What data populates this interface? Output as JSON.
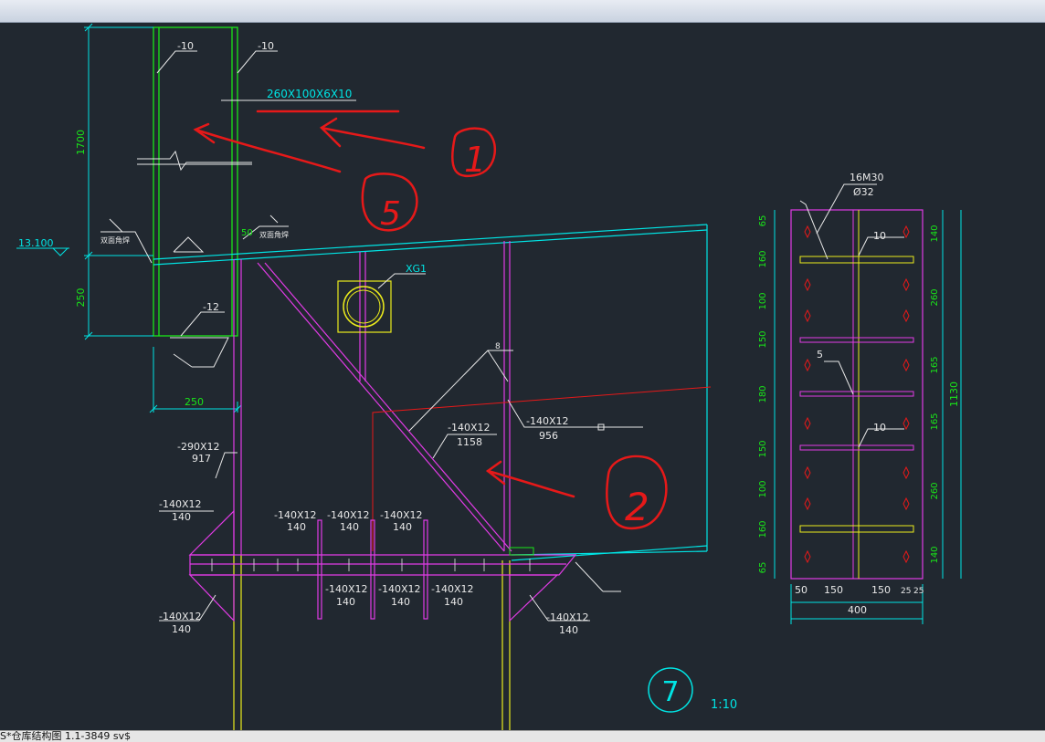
{
  "window": {
    "status_text": "S*仓库结构图 1.1-3849 sv$"
  },
  "colors": {
    "background": "#212830",
    "cyan": "#00e5e5",
    "magenta": "#e23be6",
    "yellow": "#ecec1c",
    "green": "#19e619",
    "red": "#e61919",
    "white": "#e8e8e8"
  },
  "drawing": {
    "elevation": "13.100",
    "member_section": "260X100X6X10",
    "plate_left": "-10",
    "plate_right": "-10",
    "plate_bottom": "-12",
    "dim_height": "1700",
    "dim_lower": "250",
    "dim_width": "250",
    "dim_gap": "50",
    "weld_label_a": "双面角焊",
    "weld_label_b": "双面角焊",
    "tube_label": "XG1",
    "stiffener_main": "-290X12",
    "stiffener_main_len": "917",
    "diag_brace": "-140X12",
    "diag_brace_len": "1158",
    "vert_brace": "-140X12",
    "vert_brace_len": "956",
    "weld_size_tag": "8",
    "rib_top": [
      {
        "section": "-140X12",
        "len": "140"
      },
      {
        "section": "-140X12",
        "len": "140"
      },
      {
        "section": "-140X12",
        "len": "140"
      }
    ],
    "rib_bottom": [
      {
        "section": "-140X12",
        "len": "140"
      },
      {
        "section": "-140X12",
        "len": "140"
      },
      {
        "section": "-140X12",
        "len": "140"
      }
    ],
    "rib_left_top": {
      "section": "-140X12",
      "len": "140"
    },
    "rib_left_bottom": {
      "section": "-140X12",
      "len": "140"
    },
    "rib_right_bottom": {
      "section": "-140X12",
      "len": "140"
    },
    "detail_number": "7",
    "scale": "1:10"
  },
  "annotations": {
    "mark_1": "1",
    "mark_2": "2",
    "mark_5": "5"
  },
  "side_view": {
    "bolts": "16M30",
    "hole": "Ø32",
    "weld_10_a": "10",
    "weld_10_b": "10",
    "weld_5": "5",
    "left_dims": [
      "65",
      "160",
      "100",
      "150",
      "180",
      "150",
      "100",
      "160",
      "65"
    ],
    "right_dims": [
      "140",
      "260",
      "165",
      "165",
      "260",
      "140"
    ],
    "total_height": "1130",
    "bottom_dims": [
      "50",
      "150",
      "150",
      "25",
      "25"
    ],
    "total_width": "400"
  }
}
